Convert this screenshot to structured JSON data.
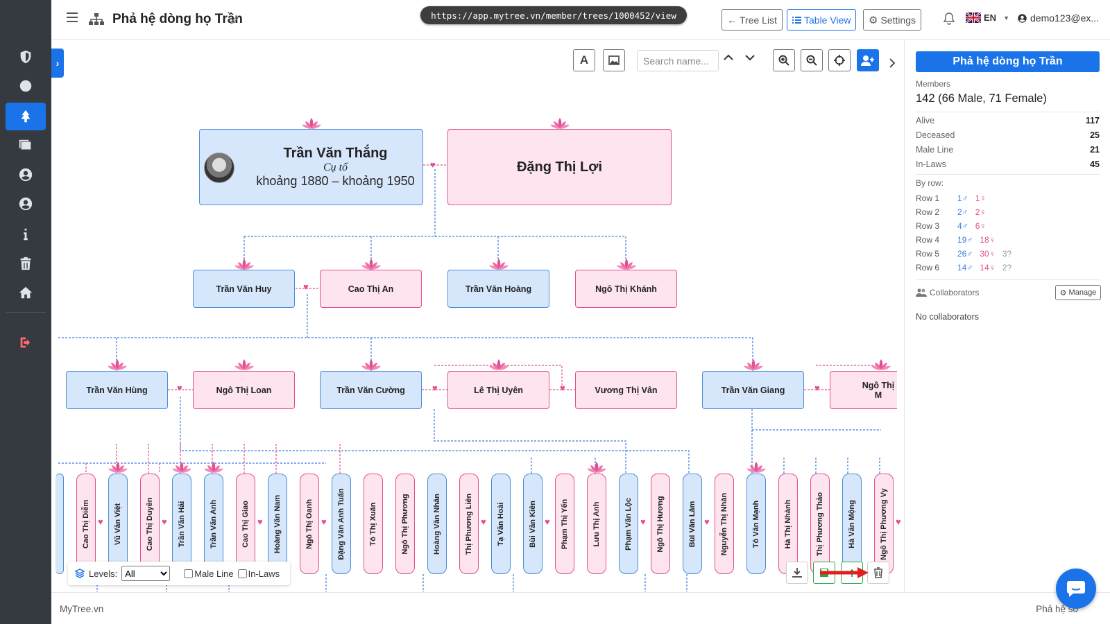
{
  "header": {
    "title": "Phả hệ dòng họ Trần",
    "url": "https://app.mytree.vn/member/trees/1000452/view",
    "tree_list_label": "Tree List",
    "table_view_label": "Table View",
    "settings_label": "Settings",
    "lang_code": "EN",
    "user_email": "demo123@ex..."
  },
  "toolbar": {
    "search_placeholder": "Search name..."
  },
  "root": {
    "name": "Trần Văn Thắng",
    "role": "Cụ tổ",
    "years": "khoảng 1880 – khoảng 1950",
    "spouse": "Đặng Thị Lợi"
  },
  "gen2": [
    "Trần Văn Huy",
    "Cao Thị An",
    "Trần Văn Hoàng",
    "Ngô Thị Khánh"
  ],
  "gen3": [
    "Trần Văn Hùng",
    "Ngô Thị Loan",
    "Trần Văn Cường",
    "Lê Thị Uyên",
    "Vương Thị Vân",
    "Trần Văn Giang",
    "Ngô Thị M"
  ],
  "gen4": [
    {
      "name": "Cao Thị Diễm",
      "g": "f"
    },
    {
      "name": "Vũ Văn Việt",
      "g": "m"
    },
    {
      "name": "Cao Thị Duyên",
      "g": "f"
    },
    {
      "name": "Trần Văn Hải",
      "g": "m"
    },
    {
      "name": "Trần Văn Anh",
      "g": "m"
    },
    {
      "name": "Cao Thị Giao",
      "g": "f"
    },
    {
      "name": "Hoàng Văn Nam",
      "g": "m"
    },
    {
      "name": "Ngô Thị Oanh",
      "g": "f"
    },
    {
      "name": "Đặng Văn Anh Tuấn",
      "g": "m"
    },
    {
      "name": "Tô Thị Xuân",
      "g": "f"
    },
    {
      "name": "Ngô Thị Phương",
      "g": "f"
    },
    {
      "name": "Hoàng Văn Nhân",
      "g": "m"
    },
    {
      "name": "Thị Phương Liên",
      "g": "f"
    },
    {
      "name": "Tạ Văn Hoài",
      "g": "m"
    },
    {
      "name": "Bùi Văn Kiên",
      "g": "m"
    },
    {
      "name": "Phạm Thị Yến",
      "g": "f"
    },
    {
      "name": "Lưu Thị Anh",
      "g": "f"
    },
    {
      "name": "Phạm Văn Lộc",
      "g": "m"
    },
    {
      "name": "Ngô Thị Hương",
      "g": "f"
    },
    {
      "name": "Bùi Văn Lâm",
      "g": "m"
    },
    {
      "name": "Nguyễn Thị Nhàn",
      "g": "f"
    },
    {
      "name": "Tô Văn Mạnh",
      "g": "m"
    },
    {
      "name": "Hà Thị Nhành",
      "g": "f"
    },
    {
      "name": "Thị Phương Thảo",
      "g": "f"
    },
    {
      "name": "Hà Văn Mộng",
      "g": "m"
    },
    {
      "name": "Ngô Thị Phương Vy",
      "g": "f"
    }
  ],
  "controls": {
    "levels_label": "Levels:",
    "levels_value": "All",
    "male_line_label": "Male Line",
    "in_laws_label": "In-Laws"
  },
  "panel": {
    "title": "Phả hệ dòng họ Trần",
    "members_label": "Members",
    "members_value": "142 (66 Male, 71 Female)",
    "stats": [
      {
        "label": "Alive",
        "value": "117"
      },
      {
        "label": "Deceased",
        "value": "25"
      },
      {
        "label": "Male Line",
        "value": "21"
      },
      {
        "label": "In-Laws",
        "value": "45"
      }
    ],
    "by_row_label": "By row:",
    "rows": [
      {
        "label": "Row 1",
        "male": "1♂",
        "female": "1♀",
        "unknown": ""
      },
      {
        "label": "Row 2",
        "male": "2♂",
        "female": "2♀",
        "unknown": ""
      },
      {
        "label": "Row 3",
        "male": "4♂",
        "female": "6♀",
        "unknown": ""
      },
      {
        "label": "Row 4",
        "male": "19♂",
        "female": "18♀",
        "unknown": ""
      },
      {
        "label": "Row 5",
        "male": "26♂",
        "female": "30♀",
        "unknown": "3?"
      },
      {
        "label": "Row 6",
        "male": "14♂",
        "female": "14♀",
        "unknown": "2?"
      }
    ],
    "collaborators_label": "Collaborators",
    "manage_label": "Manage",
    "no_collaborators": "No collaborators"
  },
  "footer": {
    "brand": "MyTree.vn",
    "right_text": "Phả hệ số"
  },
  "colors": {
    "primary": "#1a73e8",
    "male_fill": "#d6e7fb",
    "male_border": "#4a8ed8",
    "female_fill": "#fde4ef",
    "female_border": "#e0508f",
    "sidebar": "#343a40"
  }
}
